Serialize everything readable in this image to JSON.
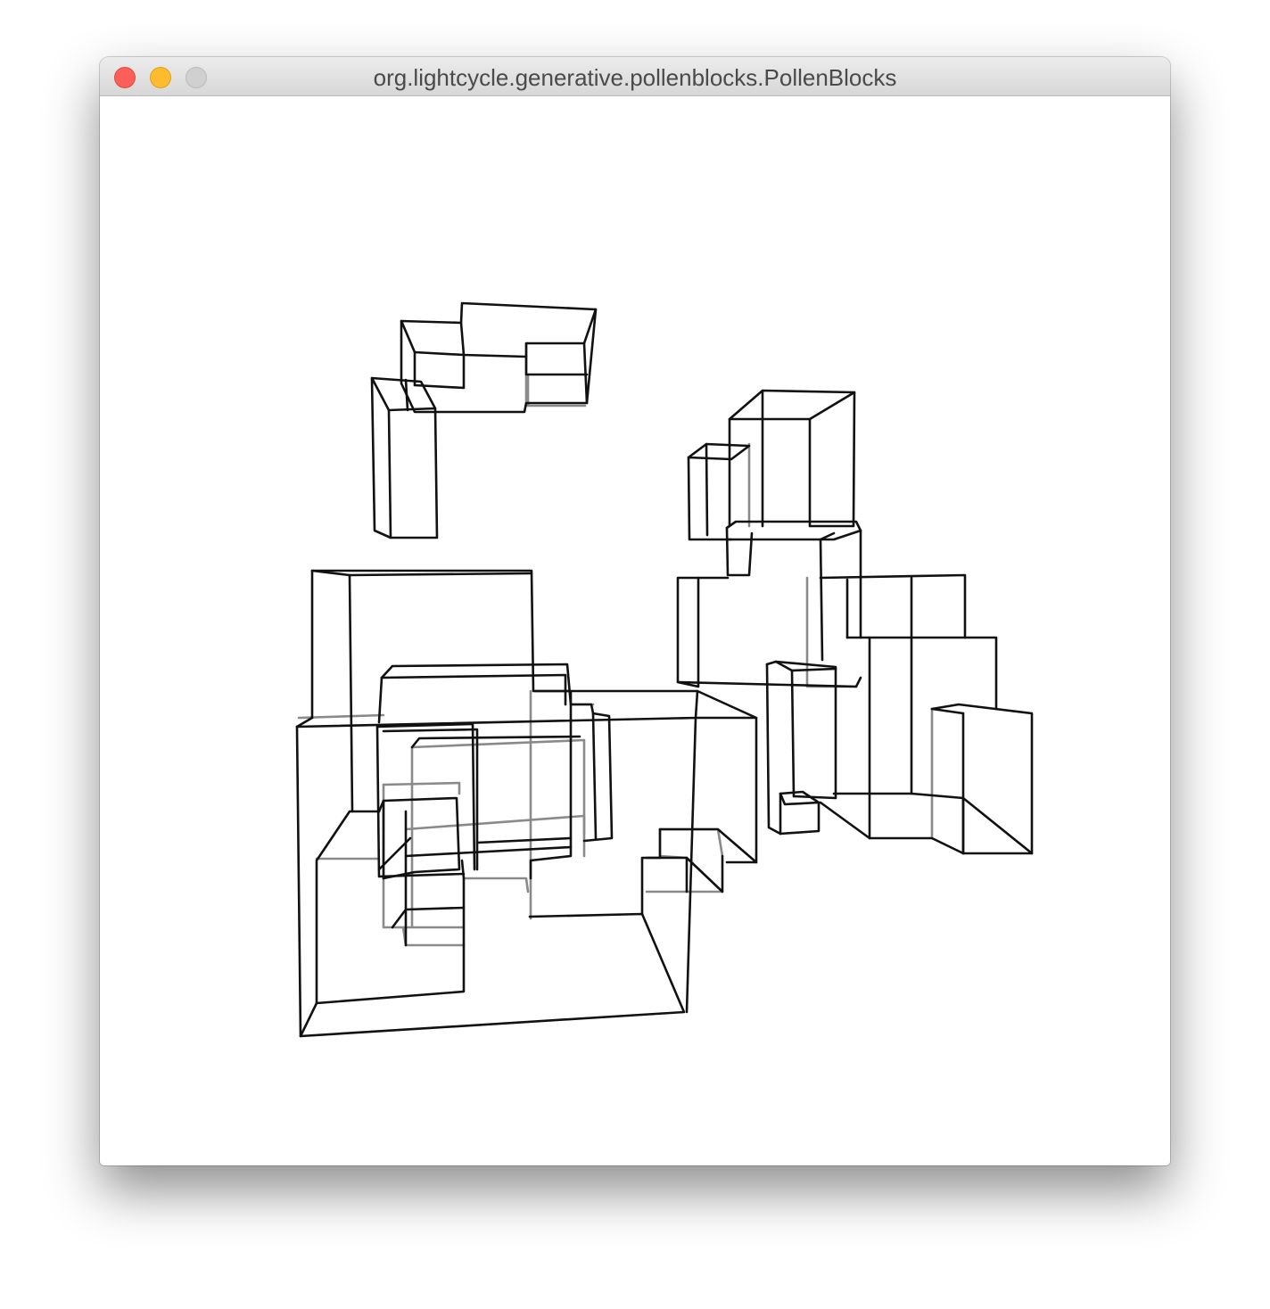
{
  "window": {
    "title": "org.lightcycle.generative.pollenblocks.PollenBlocks"
  },
  "traffic_lights": {
    "close": {
      "icon": "close-icon",
      "color": "#fc5f57"
    },
    "minimize": {
      "icon": "minimize-icon",
      "color": "#fdbc2e"
    },
    "zoom": {
      "icon": "zoom-icon",
      "color": "#d0d0d0"
    }
  },
  "canvas": {
    "background": "#ffffff",
    "line_color": "#111111",
    "back_line_color": "#8a8a8a"
  }
}
